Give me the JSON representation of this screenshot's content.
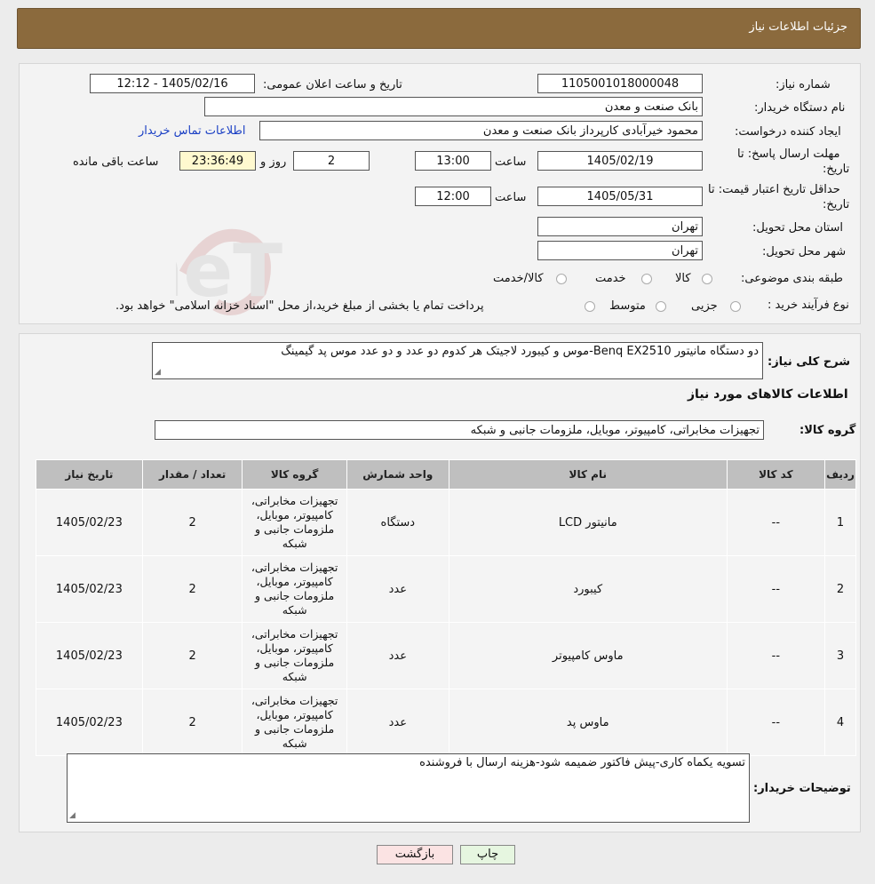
{
  "header": {
    "title": "جزئیات اطلاعات نیاز"
  },
  "form": {
    "need_number_label": "شماره نیاز:",
    "need_number": "1105001018000048",
    "announce_label": "تاریخ و ساعت اعلان عمومی:",
    "announce_value": "1405/02/16 - 12:12",
    "buyer_org_label": "نام دستگاه خریدار:",
    "buyer_org": "بانک صنعت و معدن",
    "creator_label": "ایجاد کننده درخواست:",
    "creator": "محمود خیرآبادی کارپرداز بانک صنعت و معدن",
    "contact_link": "اطلاعات تماس خریدار",
    "deadline_label_1": "مهلت ارسال پاسخ: تا",
    "deadline_label_2": "تاریخ:",
    "deadline_date": "1405/02/19",
    "time_label": "ساعت",
    "deadline_time": "13:00",
    "days_value": "2",
    "days_label": "روز و",
    "remaining_time": "23:36:49",
    "remaining_label": "ساعت باقی مانده",
    "validity_label_1": "حداقل تاریخ اعتبار قیمت: تا",
    "validity_label_2": "تاریخ:",
    "validity_date": "1405/05/31",
    "validity_time": "12:00",
    "province_label": "استان محل تحویل:",
    "province": "تهران",
    "city_label": "شهر محل تحویل:",
    "city": "تهران",
    "category_label": "طبقه بندی موضوعی:",
    "category_options": [
      "کالا",
      "خدمت",
      "کالا/خدمت"
    ],
    "purchase_label": "نوع فرآیند خرید :",
    "purchase_options": [
      "جزیی",
      "متوسط"
    ],
    "purchase_note": "پرداخت تمام یا بخشی از مبلغ خرید،از محل \"اسناد خزانه اسلامی\" خواهد بود."
  },
  "description": {
    "label": "شرح کلی نیاز:",
    "value": "دو دستگاه مانیتور Benq EX2510-موس و کیبورد لاجیتک هر کدوم دو عدد و دو عدد موس پد گیمینگ"
  },
  "goods_info_title": "اطلاعات کالاهای مورد نیاز",
  "goods_group": {
    "label": "گروه کالا:",
    "value": "تجهیزات مخابراتی، کامپیوتر، موبایل، ملزومات جانبی و شبکه"
  },
  "table": {
    "headers": [
      "ردیف",
      "کد کالا",
      "نام کالا",
      "واحد شمارش",
      "گروه کالا",
      "تعداد / مقدار",
      "تاریخ نیاز"
    ],
    "rows": [
      {
        "idx": "1",
        "code": "--",
        "name": "مانیتور LCD",
        "unit": "دستگاه",
        "group": "تجهیزات مخابراتی، کامپیوتر، موبایل، ملزومات جانبی و شبکه",
        "qty": "2",
        "date": "1405/02/23"
      },
      {
        "idx": "2",
        "code": "--",
        "name": "کیبورد",
        "unit": "عدد",
        "group": "تجهیزات مخابراتی، کامپیوتر، موبایل، ملزومات جانبی و شبکه",
        "qty": "2",
        "date": "1405/02/23"
      },
      {
        "idx": "3",
        "code": "--",
        "name": "ماوس کامپیوتر",
        "unit": "عدد",
        "group": "تجهیزات مخابراتی، کامپیوتر، موبایل، ملزومات جانبی و شبکه",
        "qty": "2",
        "date": "1405/02/23"
      },
      {
        "idx": "4",
        "code": "--",
        "name": "ماوس پد",
        "unit": "عدد",
        "group": "تجهیزات مخابراتی، کامپیوتر، موبایل، ملزومات جانبی و شبکه",
        "qty": "2",
        "date": "1405/02/23"
      }
    ]
  },
  "buyer_notes": {
    "label": "توضیحات خریدار:",
    "value": "تسویه یکماه کاری-پیش فاکتور ضمیمه شود-هزینه ارسال با فروشنده"
  },
  "buttons": {
    "print": "چاپ",
    "back": "بازگشت"
  },
  "watermark": {
    "text": "AriaTender.neT"
  },
  "colors": {
    "header_bg": "#8b6a3d",
    "link": "#1a3fc4",
    "back_btn_bg": "#fbe3e3",
    "print_btn_bg": "#e6f6e0",
    "remaining_bg": "#fff9cf"
  }
}
